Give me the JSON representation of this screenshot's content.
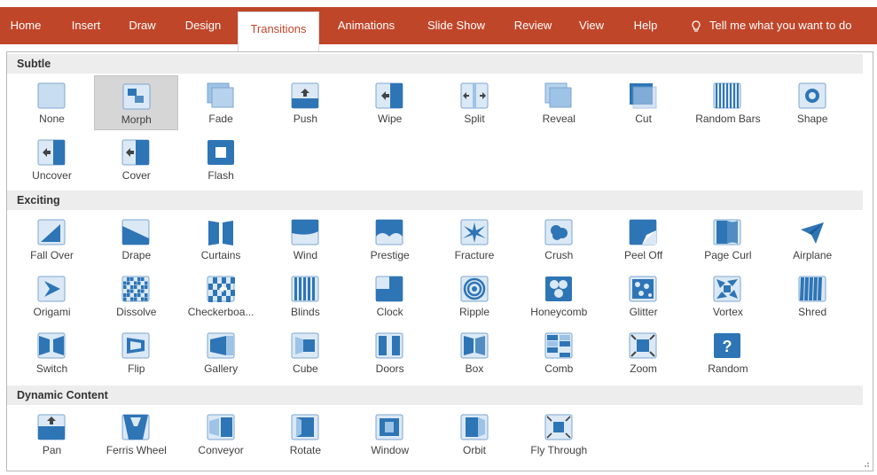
{
  "ribbon": {
    "tabs": [
      {
        "label": "Home"
      },
      {
        "label": "Insert"
      },
      {
        "label": "Draw"
      },
      {
        "label": "Design"
      },
      {
        "label": "Transitions",
        "active": true
      },
      {
        "label": "Animations"
      },
      {
        "label": "Slide Show"
      },
      {
        "label": "Review"
      },
      {
        "label": "View"
      },
      {
        "label": "Help"
      }
    ],
    "tell_me": "Tell me what you want to do",
    "tell_me_icon": "lightbulb-icon"
  },
  "colors": {
    "ribbon": "#c0462a",
    "icon_fill": "#2e75b6",
    "icon_light": "#9dc3e6"
  },
  "sections": [
    {
      "title": "Subtle",
      "items": [
        {
          "label": "None",
          "icon": "none-icon"
        },
        {
          "label": "Morph",
          "icon": "morph-icon",
          "selected": true
        },
        {
          "label": "Fade",
          "icon": "fade-icon"
        },
        {
          "label": "Push",
          "icon": "push-icon"
        },
        {
          "label": "Wipe",
          "icon": "wipe-icon"
        },
        {
          "label": "Split",
          "icon": "split-icon"
        },
        {
          "label": "Reveal",
          "icon": "reveal-icon"
        },
        {
          "label": "Cut",
          "icon": "cut-icon"
        },
        {
          "label": "Random Bars",
          "icon": "random-bars-icon"
        },
        {
          "label": "Shape",
          "icon": "shape-icon"
        },
        {
          "label": "Uncover",
          "icon": "uncover-icon"
        },
        {
          "label": "Cover",
          "icon": "cover-icon"
        },
        {
          "label": "Flash",
          "icon": "flash-icon"
        }
      ]
    },
    {
      "title": "Exciting",
      "items": [
        {
          "label": "Fall Over",
          "icon": "fall-over-icon"
        },
        {
          "label": "Drape",
          "icon": "drape-icon"
        },
        {
          "label": "Curtains",
          "icon": "curtains-icon"
        },
        {
          "label": "Wind",
          "icon": "wind-icon"
        },
        {
          "label": "Prestige",
          "icon": "prestige-icon"
        },
        {
          "label": "Fracture",
          "icon": "fracture-icon"
        },
        {
          "label": "Crush",
          "icon": "crush-icon"
        },
        {
          "label": "Peel Off",
          "icon": "peel-off-icon"
        },
        {
          "label": "Page Curl",
          "icon": "page-curl-icon"
        },
        {
          "label": "Airplane",
          "icon": "airplane-icon"
        },
        {
          "label": "Origami",
          "icon": "origami-icon"
        },
        {
          "label": "Dissolve",
          "icon": "dissolve-icon"
        },
        {
          "label": "Checkerboa...",
          "icon": "checkerboard-icon"
        },
        {
          "label": "Blinds",
          "icon": "blinds-icon"
        },
        {
          "label": "Clock",
          "icon": "clock-icon"
        },
        {
          "label": "Ripple",
          "icon": "ripple-icon"
        },
        {
          "label": "Honeycomb",
          "icon": "honeycomb-icon"
        },
        {
          "label": "Glitter",
          "icon": "glitter-icon"
        },
        {
          "label": "Vortex",
          "icon": "vortex-icon"
        },
        {
          "label": "Shred",
          "icon": "shred-icon"
        },
        {
          "label": "Switch",
          "icon": "switch-icon"
        },
        {
          "label": "Flip",
          "icon": "flip-icon"
        },
        {
          "label": "Gallery",
          "icon": "gallery-icon"
        },
        {
          "label": "Cube",
          "icon": "cube-icon"
        },
        {
          "label": "Doors",
          "icon": "doors-icon"
        },
        {
          "label": "Box",
          "icon": "box-icon"
        },
        {
          "label": "Comb",
          "icon": "comb-icon"
        },
        {
          "label": "Zoom",
          "icon": "zoom-icon"
        },
        {
          "label": "Random",
          "icon": "random-icon"
        }
      ]
    },
    {
      "title": "Dynamic Content",
      "items": [
        {
          "label": "Pan",
          "icon": "pan-icon"
        },
        {
          "label": "Ferris Wheel",
          "icon": "ferris-wheel-icon"
        },
        {
          "label": "Conveyor",
          "icon": "conveyor-icon"
        },
        {
          "label": "Rotate",
          "icon": "rotate-icon"
        },
        {
          "label": "Window",
          "icon": "window-icon"
        },
        {
          "label": "Orbit",
          "icon": "orbit-icon"
        },
        {
          "label": "Fly Through",
          "icon": "fly-through-icon"
        }
      ]
    }
  ]
}
